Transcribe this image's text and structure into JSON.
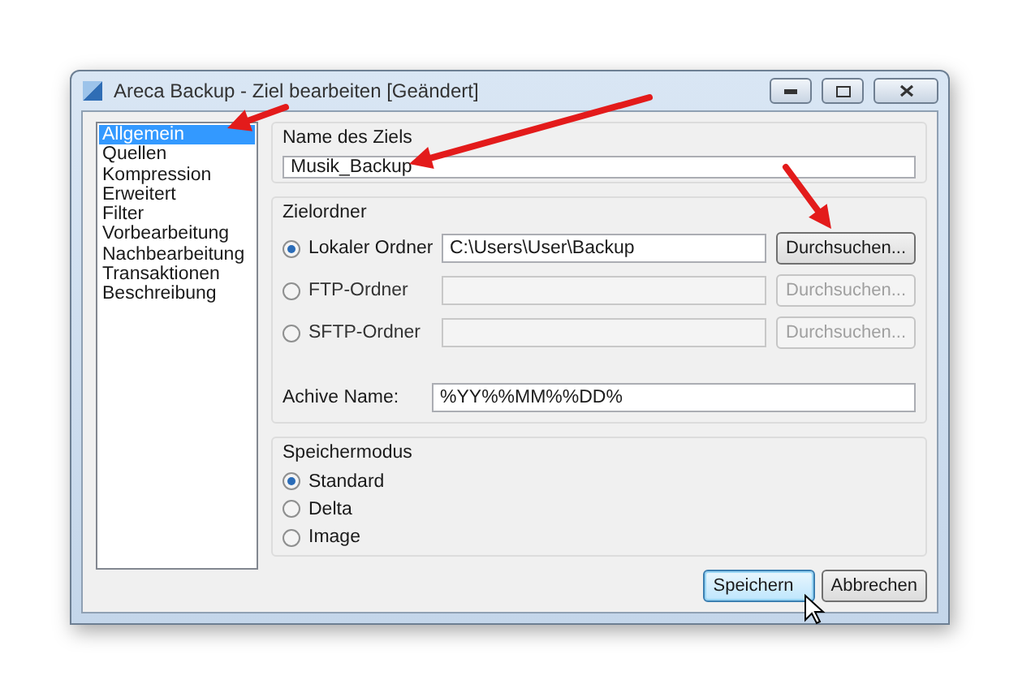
{
  "window": {
    "title": "Areca Backup - Ziel bearbeiten [Geändert]"
  },
  "sidebar": {
    "items": [
      {
        "label": "Allgemein",
        "selected": true
      },
      {
        "label": "Quellen",
        "selected": false
      },
      {
        "label": "Kompression",
        "selected": false
      },
      {
        "label": "Erweitert",
        "selected": false
      },
      {
        "label": "Filter",
        "selected": false
      },
      {
        "label": "Vorbearbeitung",
        "selected": false
      },
      {
        "label": "Nachbearbeitung",
        "selected": false
      },
      {
        "label": "Transaktionen",
        "selected": false
      },
      {
        "label": "Beschreibung",
        "selected": false
      }
    ]
  },
  "name_group": {
    "title": "Name des Ziels",
    "value": "Musik_Backup"
  },
  "folder_group": {
    "title": "Zielordner",
    "options": [
      {
        "label": "Lokaler Ordner",
        "selected": true,
        "disabled": false,
        "value": "C:\\Users\\User\\Backup",
        "button": "Durchsuchen..."
      },
      {
        "label": "FTP-Ordner",
        "selected": false,
        "disabled": true,
        "button": "Durchsuchen..."
      },
      {
        "label": "SFTP-Ordner",
        "selected": false,
        "disabled": true,
        "button": "Durchsuchen..."
      }
    ],
    "archive_name": {
      "label": "Achive Name:",
      "value": "%YY%%MM%%DD%"
    }
  },
  "mode_group": {
    "title": "Speichermodus",
    "options": [
      {
        "label": "Standard",
        "selected": true
      },
      {
        "label": "Delta",
        "selected": false
      },
      {
        "label": "Image",
        "selected": false
      }
    ]
  },
  "buttons": [
    {
      "label": "Speichern",
      "focused": true
    },
    {
      "label": "Abbrechen",
      "focused": false
    }
  ]
}
